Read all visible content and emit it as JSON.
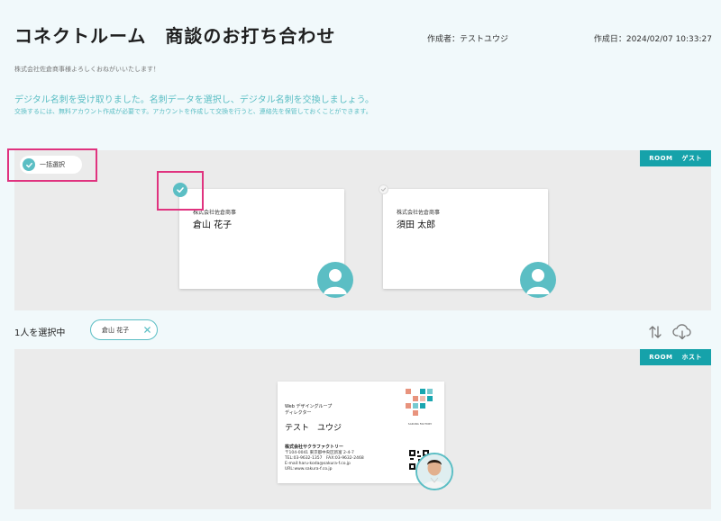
{
  "header": {
    "title": "コネクトルーム　商談のお打ち合わせ",
    "creator": "作成者：テストユウジ",
    "created_at": "作成日：2024/02/07 10:33:27"
  },
  "greeting": "株式会社佐倉商事様よろしくおねがいいたします！",
  "info": {
    "line1": "デジタル名刺を受け取りました。名刺データを選択し、デジタル名刺を交換しましょう。",
    "line2": "交換するには、無料アカウント作成が必要です。アカウントを作成して交換を行うと、連絡先を保管しておくことができます。"
  },
  "guest_panel": {
    "room_label": "ROOM",
    "role_label": "ゲスト",
    "select_all_label": "一括選択",
    "cards": [
      {
        "company": "株式会社佐倉商事",
        "name": "倉山 花子",
        "selected": true
      },
      {
        "company": "株式会社佐倉商事",
        "name": "須田 太郎",
        "selected": false
      }
    ]
  },
  "selection": {
    "count_label": "1人を選択中",
    "chips": [
      {
        "label": "倉山 花子"
      }
    ]
  },
  "host_panel": {
    "room_label": "ROOM",
    "role_label": "ホスト",
    "business_card": {
      "dept": "Web デザイングループ",
      "position": "ディレクター",
      "name": "テスト　ユウジ",
      "company": "株式会社サクラファクトリー",
      "address": "〒104-0041 東京都中央区新富 2-4-7",
      "phone": "TEL:03-9632-1357　FAX:03-9632-2468",
      "email": "E-mail:haru-koda@sakura-f.co.jp",
      "url": "URL:www.sakura-f.co.jp",
      "logo_text": "SAKURA FACTORY"
    }
  },
  "colors": {
    "accent": "#5bbec4",
    "badge": "#16a2aa",
    "highlight": "#e0337f",
    "panel": "#ebebeb",
    "background": "#f1f9fb"
  },
  "icons": {
    "sort": "sort-arrows-icon",
    "download": "cloud-download-icon",
    "remove": "close-icon",
    "check": "check-icon",
    "avatar": "user-avatar-icon"
  }
}
